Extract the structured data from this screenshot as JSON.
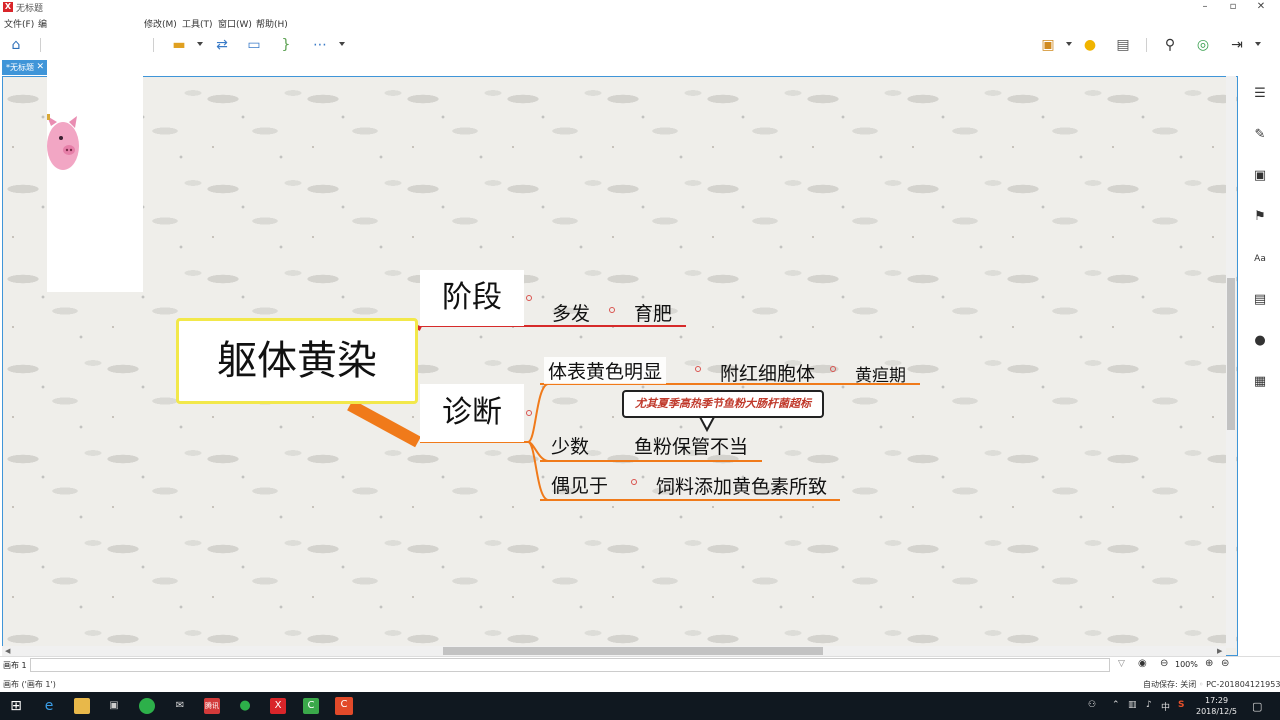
{
  "window": {
    "title": "无标题",
    "logo_text": "X",
    "minimize": "–",
    "maximize": "▫",
    "close": "✕"
  },
  "menu": {
    "file": "文件(F)",
    "edit_partial": "编",
    "modify": "修改(M)",
    "tools": "工具(T)",
    "window": "窗口(W)",
    "help": "帮助(H)"
  },
  "tab": {
    "label": "*无标题",
    "close": "✕"
  },
  "mindmap": {
    "central": "躯体黄染",
    "topics": [
      {
        "label": "阶段",
        "children": [
          "多发",
          "育肥"
        ]
      },
      {
        "label": "诊断",
        "children": [
          {
            "label": "体表黄色明显",
            "children": [
              "附红细胞体",
              "黄疸期"
            ]
          },
          {
            "label": "少数",
            "children": [
              "鱼粉保管不当"
            ],
            "callout": "尤其夏季高热季节鱼粉大肠杆菌超标"
          },
          {
            "label": "偶见于",
            "children": [
              "饲料添加黄色素所致"
            ]
          }
        ]
      }
    ]
  },
  "status": {
    "sheet_tab": "画布 1",
    "zoom": "100%",
    "sheet_label": "画布 ('画布 1')",
    "autosave": "自动保存: 关闭",
    "pc_name": "PC-201804121953"
  },
  "taskbar": {
    "time": "17:29",
    "date": "2018/12/5",
    "ime": "中",
    "brand_logo": "S",
    "tencent_label": "腾讯"
  },
  "colors": {
    "accent": "#3f95d8",
    "branch_red": "#d62a2a",
    "branch_orange": "#f07a1a",
    "central_border": "#f2e84a"
  }
}
